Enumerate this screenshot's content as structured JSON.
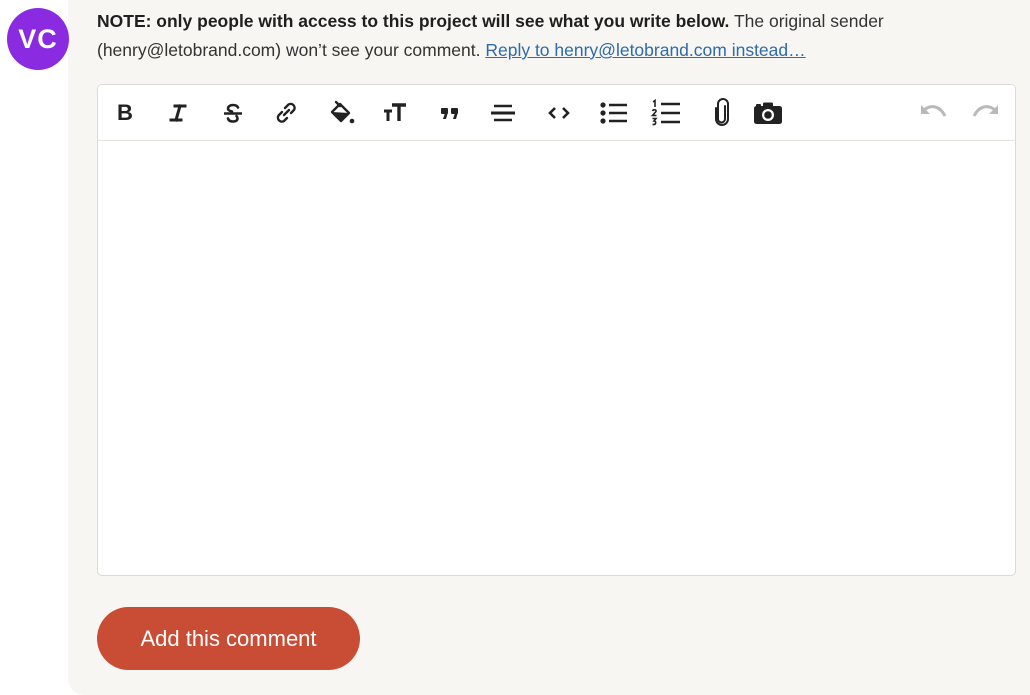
{
  "avatar": {
    "initials": "VC",
    "color": "#8a2be2"
  },
  "note": {
    "bold_text": "NOTE: only people with access to this project will see what you write below.",
    "plain_text": " The original sender (henry@letobrand.com) won’t see your comment. ",
    "link_text": "Reply to henry@letobrand.com instead…"
  },
  "toolbar": {
    "buttons": [
      {
        "icon": "bold-icon",
        "label": "B"
      },
      {
        "icon": "italic-icon"
      },
      {
        "icon": "strikethrough-icon"
      },
      {
        "icon": "link-icon"
      },
      {
        "icon": "highlight-icon"
      },
      {
        "icon": "text-size-icon"
      },
      {
        "icon": "quote-icon"
      },
      {
        "icon": "horizontal-rule-icon"
      },
      {
        "icon": "code-icon"
      },
      {
        "icon": "bullet-list-icon"
      },
      {
        "icon": "numbered-list-icon"
      },
      {
        "icon": "attachment-icon"
      },
      {
        "icon": "camera-icon"
      },
      {
        "icon": "undo-icon"
      },
      {
        "icon": "redo-icon"
      }
    ]
  },
  "editor": {
    "value": ""
  },
  "submit": {
    "label": "Add this comment",
    "color": "#c94d35"
  }
}
